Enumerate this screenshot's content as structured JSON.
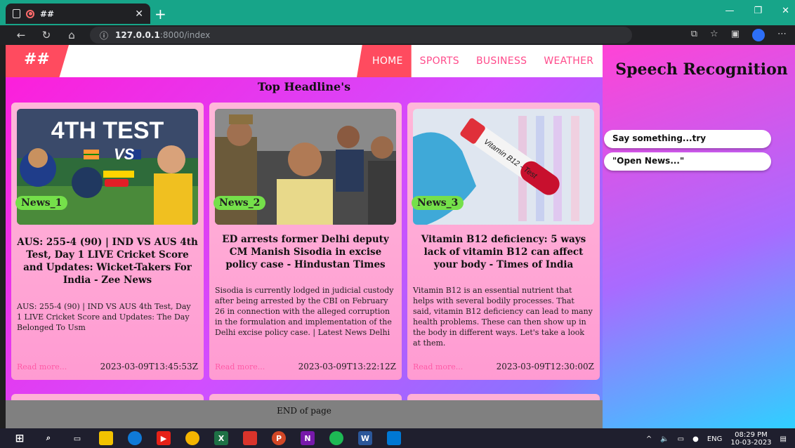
{
  "browser": {
    "tab_title": "##",
    "url_host": "127.0.0.1",
    "url_path": ":8000/index"
  },
  "nav": {
    "brand": "##",
    "links": [
      "HOME",
      "SPORTS",
      "BUSINESS",
      "WEATHER"
    ]
  },
  "main": {
    "heading": "Top Headline's",
    "cards": [
      {
        "badge": "News_1",
        "image_text": "4TH TEST",
        "title": "AUS: 255-4 (90) | IND VS AUS 4th Test, Day 1 LIVE Cricket Score and Updates: Wicket-Takers For India - Zee News",
        "description": "AUS: 255-4 (90) | IND VS AUS 4th Test, Day 1 LIVE Cricket Score and Updates: The Day Belonged To Usm",
        "read_more": "Read more...",
        "date": "2023-03-09T13:45:53Z"
      },
      {
        "badge": "News_2",
        "title": "ED arrests former Delhi deputy CM Manish Sisodia in excise policy case - Hindustan Times",
        "description": "Sisodia is currently lodged in judicial custody after being arrested by the CBI on February 26 in connection with the alleged corruption in the formulation and implementation of the Delhi excise policy case. | Latest News Delhi",
        "read_more": "Read more...",
        "date": "2023-03-09T13:22:12Z"
      },
      {
        "badge": "News_3",
        "image_text": "Vitamin B12 - Test",
        "title": "Vitamin B12 deficiency: 5 ways lack of vitamin B12 can affect your body - Times of India",
        "description": "Vitamin B12 is an essential nutrient that helps with several bodily processes. That said, vitamin B12 deficiency can lead to many health problems. These can then show up in the body in different ways. Let's take a look at them.",
        "read_more": "Read more...",
        "date": "2023-03-09T12:30:00Z"
      }
    ],
    "footer": "END of page"
  },
  "speech": {
    "title": "Speech Recognition",
    "prompts": [
      "Say something...try",
      "\"Open News...\""
    ]
  },
  "taskbar": {
    "lang": "ENG",
    "time": "08:29 PM",
    "date": "10-03-2023"
  }
}
